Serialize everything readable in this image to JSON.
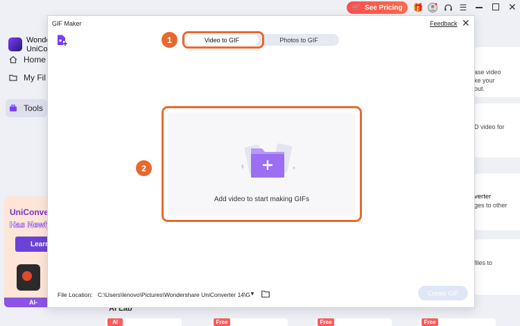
{
  "topbar": {
    "pricing_label": "See Pricing",
    "icons": [
      "cart-icon",
      "gift-icon",
      "user-icon",
      "headset-icon",
      "menu-icon"
    ]
  },
  "sidebar": {
    "app_name_line1": "Wonde",
    "app_name_line2": "UniCon",
    "items": [
      {
        "label": "Home",
        "icon": "home-icon"
      },
      {
        "label": "My Fil",
        "icon": "folder-icon"
      },
      {
        "label": "Tools",
        "icon": "toolbox-icon",
        "active": true
      }
    ],
    "promo": {
      "title_line1": "UniConve",
      "title_line2": "Has Newly",
      "button_label": "Learn",
      "footer": "AI-Pow"
    }
  },
  "background_cards": [
    {
      "line1": "ase video",
      "line2": "ke your",
      "line3": "out."
    },
    {
      "line1": "D video for",
      "line2": "",
      "line3": ""
    },
    {
      "line1": "verter",
      "line2": "ges to other",
      "line3": ""
    },
    {
      "line1": "files to",
      "line2": "",
      "line3": ""
    }
  ],
  "ai_lab_label": "AI Lab",
  "tags": [
    "AI",
    "Free",
    "Free",
    "Free"
  ],
  "modal": {
    "title": "GIF Maker",
    "feedback_label": "Feedback",
    "tabs": [
      {
        "label": "Video to GIF",
        "active": true
      },
      {
        "label": "Photos to GIF",
        "active": false
      }
    ],
    "steps": [
      "1",
      "2"
    ],
    "dropzone_text": "Add video to start making GIFs",
    "file_location_label": "File Location:",
    "file_location_value": "C:\\Users\\lenovo\\Pictures\\Wondershare UniConverter 14\\G",
    "create_label": "Create GIF"
  },
  "colors": {
    "accent": "#e8692d",
    "brand": "#6b42d8",
    "pricing": "#ff5a4a"
  }
}
